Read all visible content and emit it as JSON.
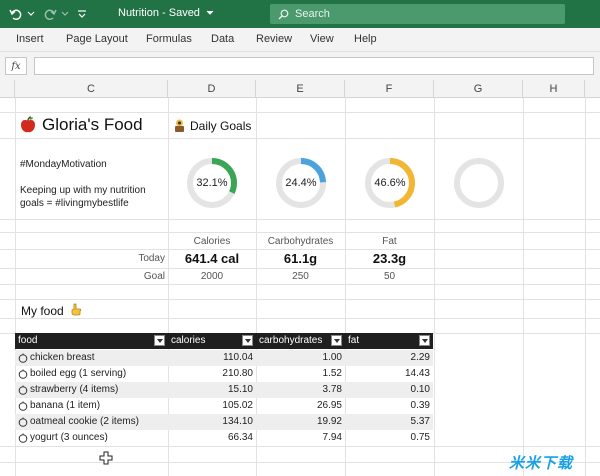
{
  "titlebar": {
    "title": "Nutrition  -  Saved",
    "search_placeholder": "Search",
    "bg_color": "#217346"
  },
  "ribbon": {
    "tabs": [
      "Insert",
      "Page Layout",
      "Formulas",
      "Data",
      "Review",
      "View",
      "Help"
    ]
  },
  "formula_bar": {
    "fx_label": "fx",
    "value": ""
  },
  "columns": [
    "C",
    "D",
    "E",
    "F",
    "G",
    "H"
  ],
  "sheet": {
    "title": "Gloria's Food",
    "goals_label": "Daily Goals",
    "note1": "#MondayMotivation",
    "note2": "Keeping up with my nutrition",
    "note3": "goals = #livingmybestlife",
    "donuts": [
      {
        "label": "32.1%",
        "fraction": 0.321,
        "color": "#3aa655"
      },
      {
        "label": "24.4%",
        "fraction": 0.244,
        "color": "#4aa3dd"
      },
      {
        "label": "46.6%",
        "fraction": 0.466,
        "color": "#f2b632"
      },
      {
        "label": "",
        "fraction": 0,
        "color": "#dddddd"
      }
    ],
    "metric_headers": [
      "Calories",
      "Carbohydrates",
      "Fat"
    ],
    "row_today": "Today",
    "row_goal": "Goal",
    "today_values": [
      "641.4 cal",
      "61.1g",
      "23.3g"
    ],
    "goal_values": [
      "2000",
      "250",
      "50"
    ],
    "myfood_label": "My food"
  },
  "table": {
    "headers": [
      "food",
      "calories",
      "carbohydrates",
      "fat"
    ],
    "rows": [
      {
        "food": "chicken breast",
        "calories": "110.04",
        "carbs": "1.00",
        "fat": "2.29"
      },
      {
        "food": "boiled egg (1 serving)",
        "calories": "210.80",
        "carbs": "1.52",
        "fat": "14.43"
      },
      {
        "food": "strawberry (4 items)",
        "calories": "15.10",
        "carbs": "3.78",
        "fat": "0.10"
      },
      {
        "food": "banana (1 item)",
        "calories": "105.02",
        "carbs": "26.95",
        "fat": "0.39"
      },
      {
        "food": "oatmeal cookie (2 items)",
        "calories": "134.10",
        "carbs": "19.92",
        "fat": "5.37"
      },
      {
        "food": "yogurt (3 ounces)",
        "calories": "66.34",
        "carbs": "7.94",
        "fat": "0.75"
      }
    ]
  },
  "watermark": "米米下载"
}
